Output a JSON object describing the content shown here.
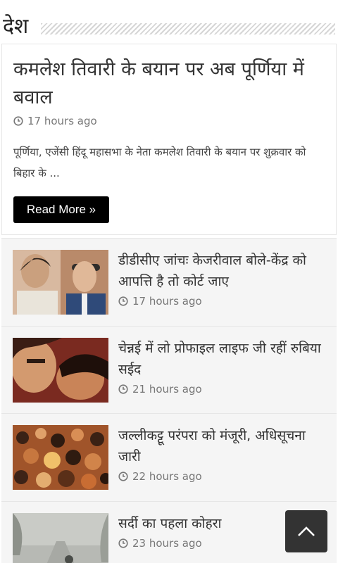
{
  "section": {
    "title": "देश"
  },
  "featured": {
    "title": "कमलेश तिवारी के बयान पर अब पूर्णिया में बवाल",
    "time": "17 hours ago",
    "excerpt": "पूर्णिया, एजेंसी हिंदू महासभा के नेता कमलेश तिवारी के बयान पर शुक्रवार को बिहार के ...",
    "read_more": "Read More »"
  },
  "articles": [
    {
      "title": "डीडीसीए जांचः केजरीवाल बोले-केंद्र को आपत्ति है तो कोर्ट जाए",
      "time": "17 hours ago"
    },
    {
      "title": "चेन्नई में लो प्रोफाइल लाइफ जी रहीं रुबिया सईद",
      "time": "21 hours ago"
    },
    {
      "title": "जल्लीकट्टू परंपरा को मंजूरी, अधिसूचना जारी",
      "time": "22 hours ago"
    },
    {
      "title": "सर्दी का पहला कोहरा",
      "time": "23 hours ago"
    }
  ],
  "icons": {
    "clock": "clock-icon",
    "scroll_top": "chevron-up-icon"
  },
  "colors": {
    "button": "#000000",
    "scroll_top": "#333333"
  }
}
